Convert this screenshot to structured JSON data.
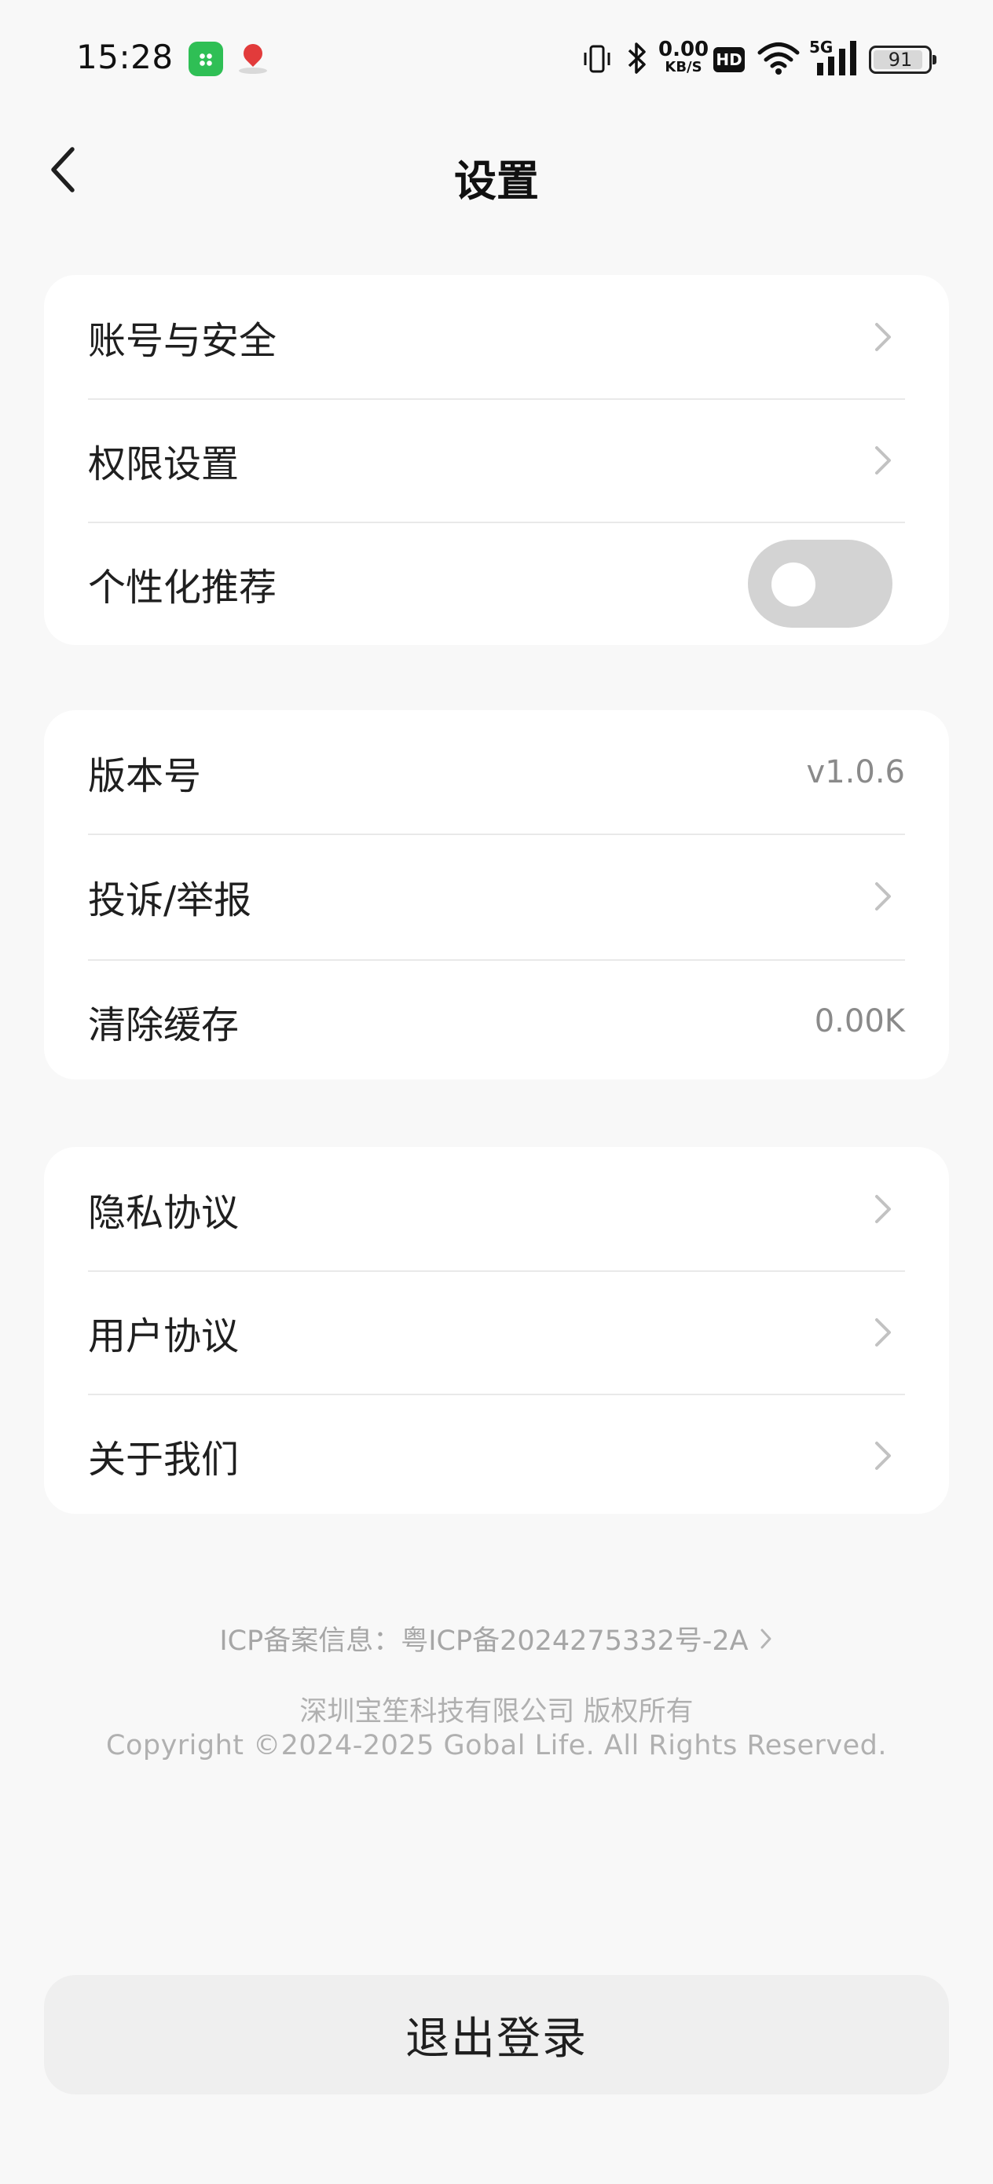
{
  "status_bar": {
    "time": "15:28",
    "net_speed_value": "0.00",
    "net_speed_unit": "KB/S",
    "hd_label": "HD",
    "signal_label": "5G",
    "battery": "91",
    "battery_level": 0.91,
    "icons": [
      "app-store-icon",
      "map-pin-icon",
      "vibrate-icon",
      "bluetooth-icon",
      "wifi-icon",
      "signal-icon",
      "battery-icon"
    ]
  },
  "header": {
    "title": "设置",
    "back_icon": "chevron-left-icon"
  },
  "section1": {
    "account_security": "账号与安全",
    "permissions": "权限设置",
    "personalized": "个性化推荐",
    "personalized_enabled": false
  },
  "section2": {
    "version_label": "版本号",
    "version_value": "v1.0.6",
    "report_label": "投诉/举报",
    "cache_label": "清除缓存",
    "cache_value": "0.00K"
  },
  "section3": {
    "privacy": "隐私协议",
    "user_agreement": "用户协议",
    "about": "关于我们"
  },
  "footer": {
    "icp": "ICP备案信息：粤ICP备2024275332号-2A",
    "company": "深圳宝笙科技有限公司 版权所有",
    "copyright": "Copyright ©2024-2025 Gobal Life. All Rights Reserved."
  },
  "logout": {
    "label": "退出登录"
  },
  "colors": {
    "background": "#f8f8f8",
    "card": "#ffffff",
    "toggle_off": "#d3d3d3",
    "muted_text": "#8a8a8a",
    "logout_bg": "#efefef"
  }
}
